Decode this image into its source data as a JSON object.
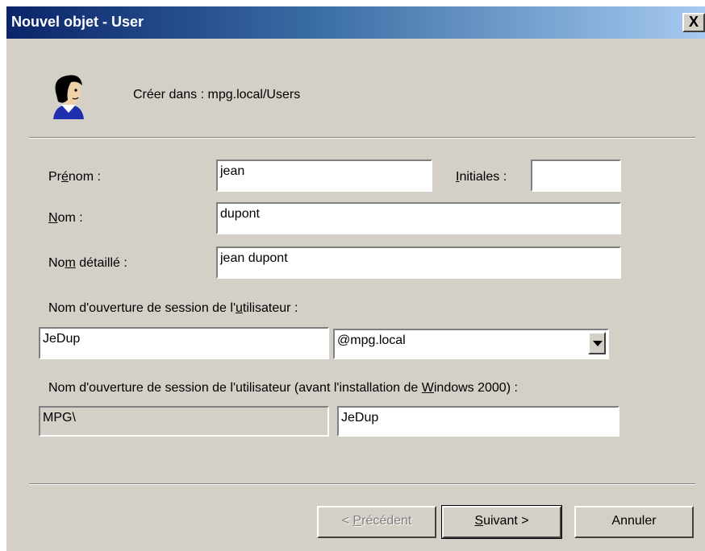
{
  "window": {
    "title": "Nouvel objet - User",
    "close_glyph": "X"
  },
  "header": {
    "icon": "user-icon",
    "create_in_label": "Créer dans :",
    "create_in_value": "mpg.local/Users"
  },
  "form": {
    "prenom_label": {
      "before": "Pr",
      "accel": "é",
      "after": "nom :"
    },
    "prenom_value": "jean",
    "initiales_label": {
      "before": "",
      "accel": "I",
      "after": "nitiales :"
    },
    "initiales_value": "",
    "nom_label": {
      "before": "",
      "accel": "N",
      "after": "om :"
    },
    "nom_value": "dupont",
    "nom_detaille_label": {
      "before": "No",
      "accel": "m",
      "after": " détaillé :"
    },
    "nom_detaille_value": "jean dupont",
    "logon_label": {
      "before": "Nom d'ouverture de session de l'",
      "accel": "u",
      "after": "tilisateur :"
    },
    "logon_value": "JeDup",
    "domain_selected": "@mpg.local",
    "prewin2000_label": {
      "before": "Nom d'ouverture de session de l'utilisateur (avant l'installation de ",
      "accel": "W",
      "after": "indows 2000) :"
    },
    "prewin2000_domain": "MPG\\",
    "prewin2000_value": "JeDup"
  },
  "buttons": {
    "back": {
      "before": "< ",
      "accel": "P",
      "after": "récédent"
    },
    "next": {
      "before": "",
      "accel": "S",
      "after": "uivant >"
    },
    "cancel": "Annuler"
  },
  "colors": {
    "title_start": "#0a246a",
    "title_end": "#a6caf0",
    "dialog_bg": "#d4d0c8"
  }
}
